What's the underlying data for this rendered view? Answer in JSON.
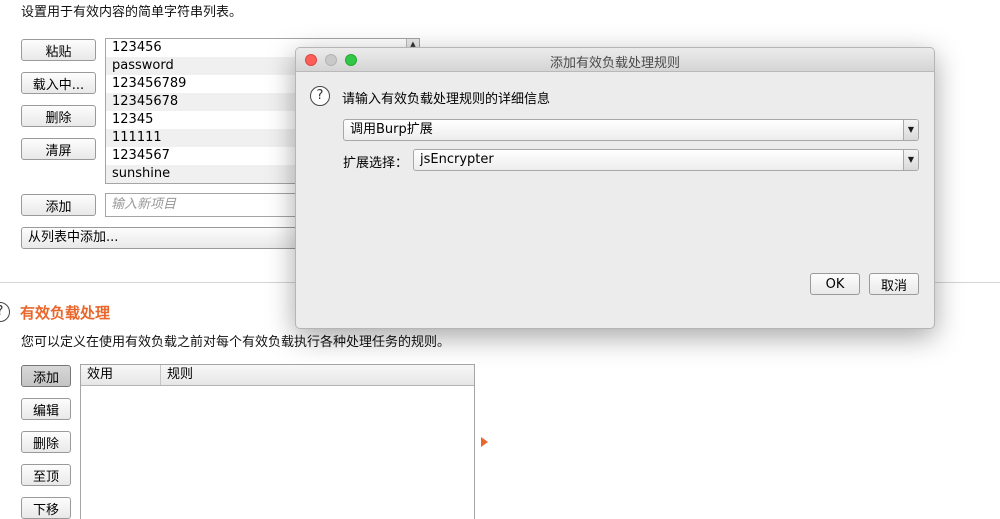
{
  "intro_text": "设置用于有效内容的简单字符串列表。",
  "list_buttons": {
    "paste": "粘贴",
    "load": "载入中...",
    "remove": "删除",
    "clear": "清屏",
    "add": "添加"
  },
  "payload_list": [
    "123456",
    "password",
    "123456789",
    "12345678",
    "12345",
    "111111",
    "1234567",
    "sunshine"
  ],
  "new_item_placeholder": "输入新项目",
  "add_from_list": "从列表中添加...",
  "processing": {
    "title": "有效负载处理",
    "description": "您可以定义在使用有效负载之前对每个有效负载执行各种处理任务的规则。",
    "buttons": {
      "add": "添加",
      "edit": "编辑",
      "remove": "删除",
      "top": "至顶",
      "down": "下移"
    },
    "table_columns": [
      "效用",
      "规则"
    ]
  },
  "dialog": {
    "title": "添加有效负载处理规则",
    "prompt": "请输入有效负载处理规则的详细信息",
    "rule_type": "调用Burp扩展",
    "extension_label": "扩展选择：",
    "extension_value": "jsEncrypter",
    "ok": "OK",
    "cancel": "取消"
  },
  "colors": {
    "accent": "#e8672c"
  }
}
